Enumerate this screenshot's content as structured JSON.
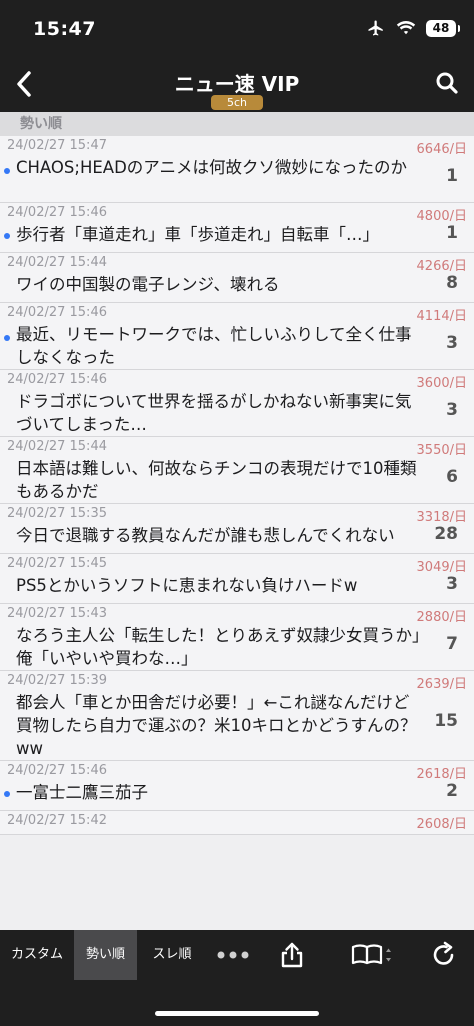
{
  "status": {
    "time": "15:47",
    "battery": "48"
  },
  "nav": {
    "title": "ニュー速 VIP",
    "badge": "5ch"
  },
  "section": {
    "label": "勢い順"
  },
  "threads": [
    {
      "date": "24/02/27 15:47",
      "speed": "6646/日",
      "title": "CHAOS;HEADのアニメは何故クソ微妙になったのか",
      "count": "1",
      "unread": true
    },
    {
      "date": "24/02/27 15:46",
      "speed": "4800/日",
      "title": "歩行者「車道走れ」車「歩道走れ」自転車「…」",
      "count": "1",
      "unread": true
    },
    {
      "date": "24/02/27 15:44",
      "speed": "4266/日",
      "title": "ワイの中国製の電子レンジ、壊れる",
      "count": "8",
      "unread": false
    },
    {
      "date": "24/02/27 15:46",
      "speed": "4114/日",
      "title": "最近、リモートワークでは、忙しいふりして全く仕事しなくなった",
      "count": "3",
      "unread": true
    },
    {
      "date": "24/02/27 15:46",
      "speed": "3600/日",
      "title": "ドラゴボについて世界を揺るがしかねない新事実に気づいてしまった…",
      "count": "3",
      "unread": false
    },
    {
      "date": "24/02/27 15:44",
      "speed": "3550/日",
      "title": "日本語は難しい、何故ならチンコの表現だけで10種類もあるかだ",
      "count": "6",
      "unread": false
    },
    {
      "date": "24/02/27 15:35",
      "speed": "3318/日",
      "title": "今日で退職する教員なんだが誰も悲しんでくれない",
      "count": "28",
      "unread": false
    },
    {
      "date": "24/02/27 15:45",
      "speed": "3049/日",
      "title": "PS5とかいうソフトに恵まれない負けハードw",
      "count": "3",
      "unread": false
    },
    {
      "date": "24/02/27 15:43",
      "speed": "2880/日",
      "title": "なろう主人公「転生した！とりあえず奴隷少女買うか」俺「いやいや買わな…」",
      "count": "7",
      "unread": false
    },
    {
      "date": "24/02/27 15:39",
      "speed": "2639/日",
      "title": "都会人「車とか田舎だけ必要！」←これ謎なんだけど買物したら自力で運ぶの？米10キロとかどうすんの？ww",
      "count": "15",
      "unread": false
    },
    {
      "date": "24/02/27 15:46",
      "speed": "2618/日",
      "title": "一富士二鷹三茄子",
      "count": "2",
      "unread": true
    },
    {
      "date": "24/02/27 15:42",
      "speed": "2608/日",
      "title": "",
      "count": "",
      "unread": false
    }
  ],
  "tabs": {
    "custom": "カスタム",
    "momentum": "勢い順",
    "thread_order": "スレ順"
  },
  "colors": {
    "bar": "#1f1f1f",
    "accent_badge": "#b88a3a",
    "speed": "#d07a7a",
    "unread_dot": "#3478f6"
  },
  "icons": [
    "back-chevron-icon",
    "search-icon",
    "more-dots-icon",
    "share-icon",
    "book-icon",
    "reload-icon",
    "airplane-icon",
    "wifi-icon",
    "battery-icon"
  ]
}
